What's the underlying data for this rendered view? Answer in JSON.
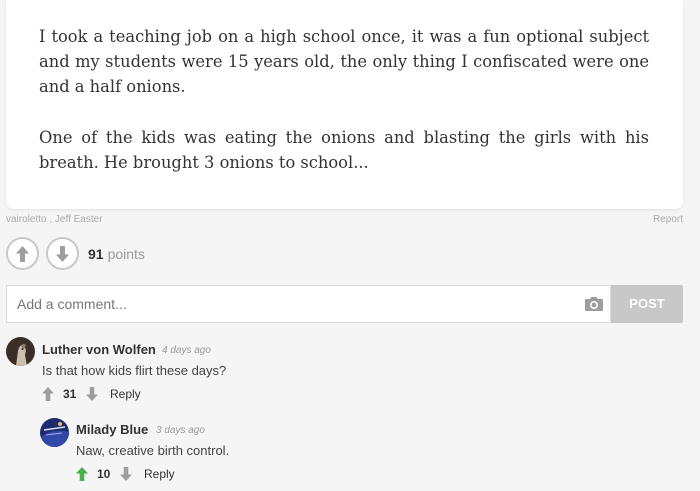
{
  "post": {
    "paragraphs": [
      "I took a teaching job on a high school once, it was a fun optional subject and my students were 15 years old, the only thing I confiscated were one and a half onions.",
      "One of the kids was eating the onions and blasting the girls with his breath. He brought 3 onions to school..."
    ],
    "authors": "vairoletto ,  Jeff Easter",
    "report_label": "Report",
    "points": "91",
    "points_label": "points"
  },
  "comment_form": {
    "placeholder": "Add a comment...",
    "post_label": "POST"
  },
  "comments": [
    {
      "author": "Luther von Wolfen",
      "time": "4 days ago",
      "text": "Is that how kids flirt these days?",
      "votes": "31",
      "reply_label": "Reply"
    },
    {
      "author": "Milady Blue",
      "time": "3 days ago",
      "text": "Naw, creative birth control.",
      "votes": "10",
      "reply_label": "Reply"
    }
  ],
  "colors": {
    "upvoted": "#4caf50",
    "neutral_arrow": "#9e9e9e",
    "post_button": "#c8c8c8"
  },
  "icons": [
    "arrow-up-icon",
    "arrow-down-icon",
    "camera-icon"
  ]
}
